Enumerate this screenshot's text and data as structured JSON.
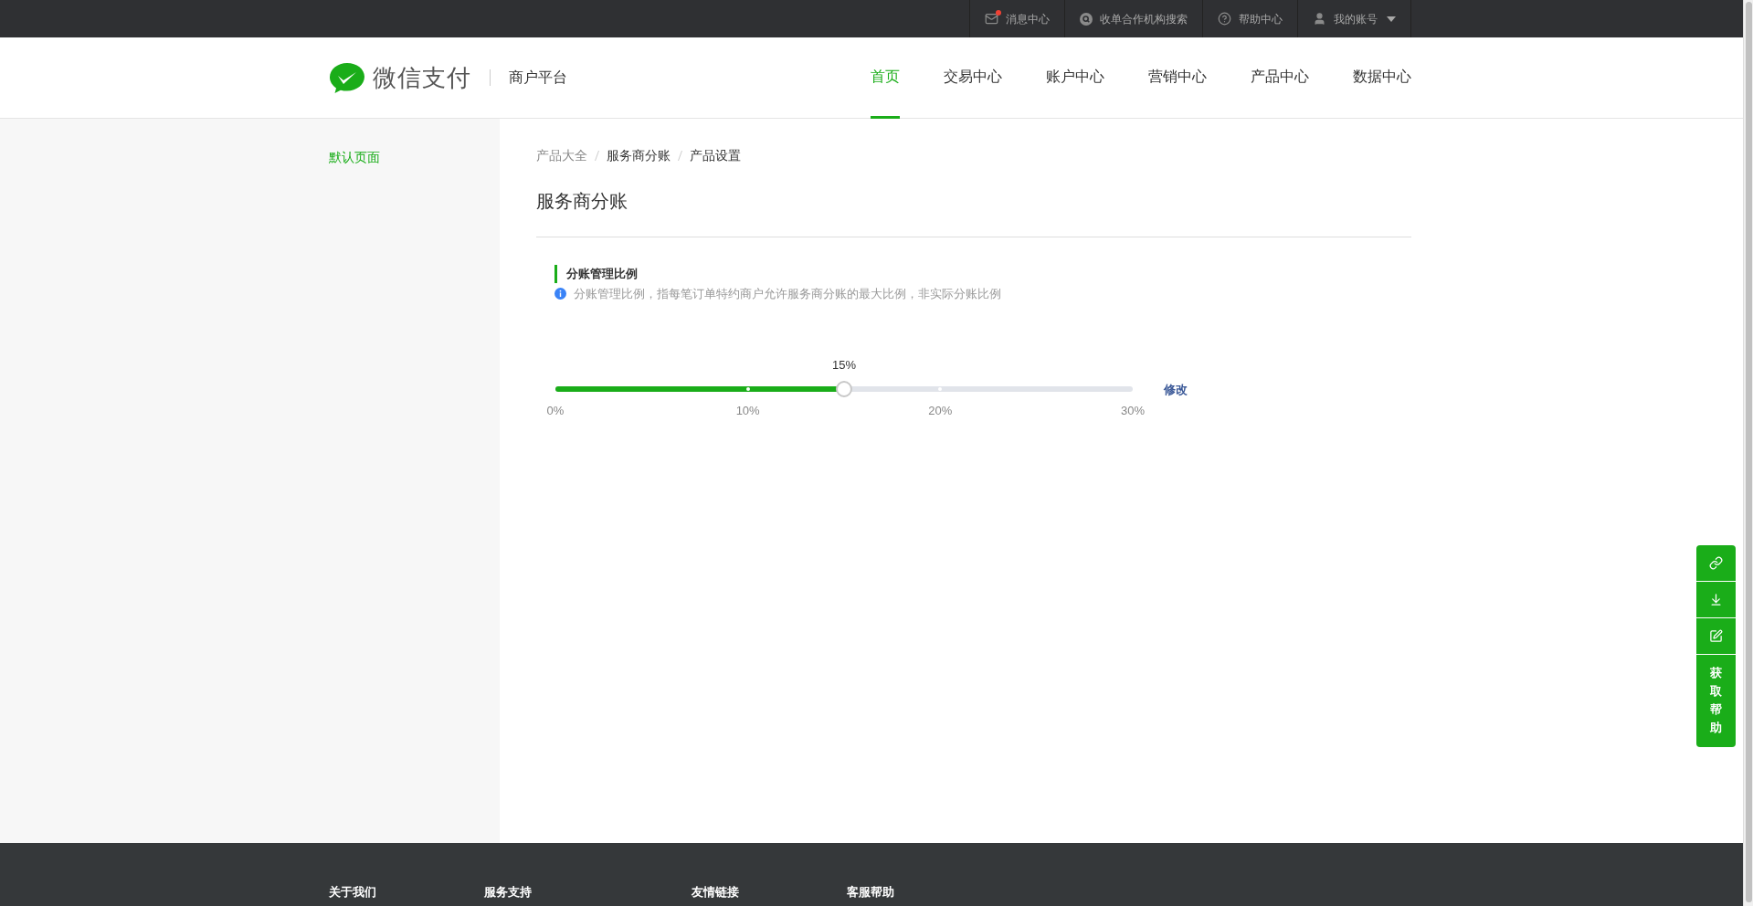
{
  "top_bar": {
    "items": [
      {
        "kind": "messages",
        "label": "消息中心",
        "unread": true
      },
      {
        "kind": "search",
        "label": "收单合作机构搜索"
      },
      {
        "kind": "help",
        "label": "帮助中心"
      },
      {
        "kind": "account",
        "label": "我的账号"
      }
    ]
  },
  "header": {
    "logo_text": "微信支付",
    "platform": "商户平台",
    "nav": [
      {
        "label": "首页",
        "selected": true
      },
      {
        "label": "交易中心",
        "selected": false
      },
      {
        "label": "账户中心",
        "selected": false
      },
      {
        "label": "营销中心",
        "selected": false
      },
      {
        "label": "产品中心",
        "selected": false
      },
      {
        "label": "数据中心",
        "selected": false
      }
    ]
  },
  "sidebar": {
    "items": [
      {
        "label": "默认页面",
        "selected": true
      }
    ]
  },
  "breadcrumb": [
    "产品大全",
    "服务商分账",
    "产品设置"
  ],
  "page_title": "服务商分账",
  "section": {
    "title": "分账管理比例",
    "note": "分账管理比例，指每笔订单特约商户允许服务商分账的最大比例，非实际分账比例"
  },
  "slider": {
    "value_label": "15%",
    "level": 0.5,
    "ticks": [
      "0%",
      "10%",
      "20%",
      "30%"
    ],
    "action": "修改"
  },
  "float_tools": [
    {
      "kind": "link"
    },
    {
      "kind": "download"
    },
    {
      "kind": "edit"
    },
    {
      "kind": "text",
      "label": "获取帮助"
    }
  ],
  "footer": {
    "columns": [
      "关于我们",
      "服务支持",
      "友情链接",
      "客服帮助"
    ]
  }
}
